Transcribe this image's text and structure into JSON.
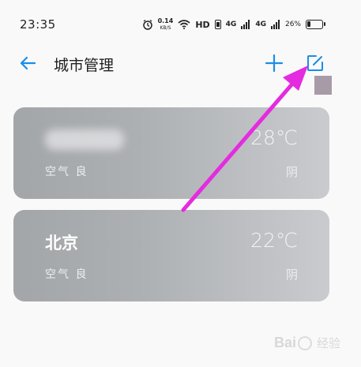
{
  "status_bar": {
    "time": "23:35",
    "net_speed_value": "0.14",
    "net_speed_unit": "KB/S",
    "hd_label": "HD",
    "signal_1_label": "4G",
    "signal_2_label": "4G",
    "battery_percent": "26%",
    "battery_level": 0.26
  },
  "header": {
    "title": "城市管理",
    "icons": [
      "back-arrow-icon",
      "plus-icon",
      "edit-icon"
    ]
  },
  "cities": [
    {
      "name": "",
      "temperature": "28℃",
      "air_quality": "空气 良",
      "weather": "阴"
    },
    {
      "name": "北京",
      "temperature": "22℃",
      "air_quality": "空气 良",
      "weather": "阴"
    }
  ],
  "annotation": {
    "arrow_color": "#e52be0"
  },
  "watermark": {
    "text_latin": "Bai",
    "text_cn": "经验"
  },
  "colors": {
    "accent": "#1a8ee8",
    "card_gray": "#a9acaf",
    "background": "#f9f9f9"
  }
}
